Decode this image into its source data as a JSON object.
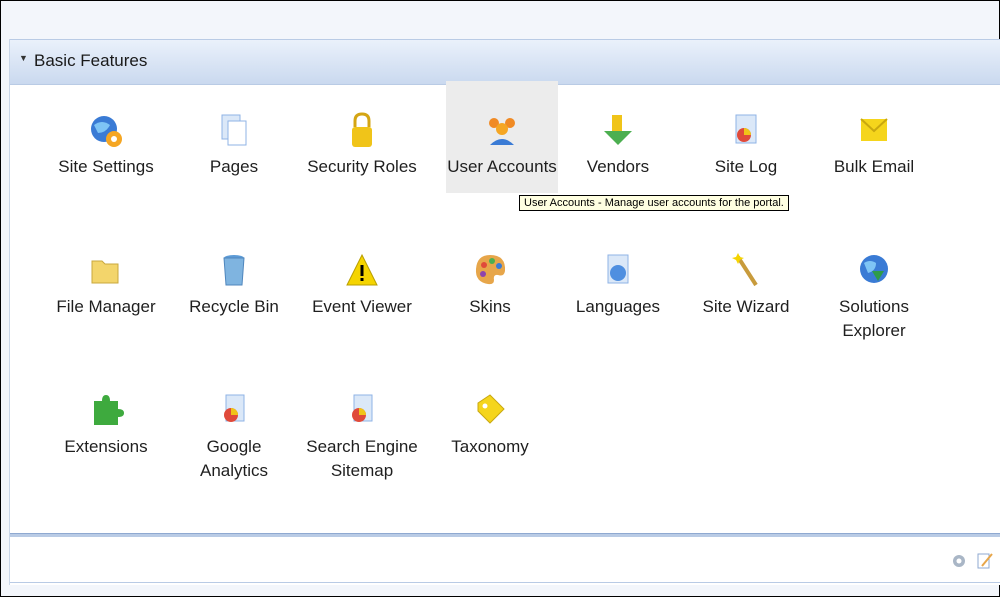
{
  "section": {
    "title": "Basic Features",
    "collapse_icon": "triangle-down-icon"
  },
  "tiles": [
    {
      "label": "Site Settings",
      "icon": "site-settings-icon",
      "color": "#3a7bd5"
    },
    {
      "label": "Pages",
      "icon": "pages-icon",
      "color": "#8fb3e6"
    },
    {
      "label": "Security Roles",
      "icon": "lock-icon",
      "color": "#f0c419"
    },
    {
      "label": "User Accounts",
      "icon": "users-icon",
      "color": "#f08a24"
    },
    {
      "label": "Vendors",
      "icon": "vendors-icon",
      "color": "#4caf50"
    },
    {
      "label": "Site Log",
      "icon": "site-log-icon",
      "color": "#e04a3a"
    },
    {
      "label": "Bulk Email",
      "icon": "envelope-icon",
      "color": "#f5d51c"
    },
    {
      "label": "File Manager",
      "icon": "folder-icon",
      "color": "#f3d56b"
    },
    {
      "label": "Recycle Bin",
      "icon": "recycle-bin-icon",
      "color": "#7fb4e0"
    },
    {
      "label": "Event Viewer",
      "icon": "warning-icon",
      "color": "#f5d400"
    },
    {
      "label": "Skins",
      "icon": "palette-icon",
      "color": "#e7a64a"
    },
    {
      "label": "Languages",
      "icon": "languages-icon",
      "color": "#4f8fe0"
    },
    {
      "label": "Site Wizard",
      "icon": "magic-wand-icon",
      "color": "#c89b3c"
    },
    {
      "label": "Solutions\nExplorer",
      "icon": "solutions-explorer-icon",
      "color": "#2e9c4a"
    },
    {
      "label": "Extensions",
      "icon": "puzzle-icon",
      "color": "#3eaa3e"
    },
    {
      "label": "Google\nAnalytics",
      "icon": "analytics-icon",
      "color": "#e04a3a"
    },
    {
      "label": "Search Engine\nSitemap",
      "icon": "sitemap-icon",
      "color": "#e04a3a"
    },
    {
      "label": "Taxonomy",
      "icon": "tag-icon",
      "color": "#f5d51c"
    }
  ],
  "tooltip": {
    "text": "User Accounts - Manage user accounts for the portal."
  },
  "footer": {
    "icons": [
      "settings-icon",
      "edit-icon"
    ]
  },
  "colors": {
    "header_top": "#eaf1fb",
    "header_bottom": "#cad9ef",
    "tooltip_bg": "#ffffe1",
    "hover_bg": "#ececec"
  }
}
